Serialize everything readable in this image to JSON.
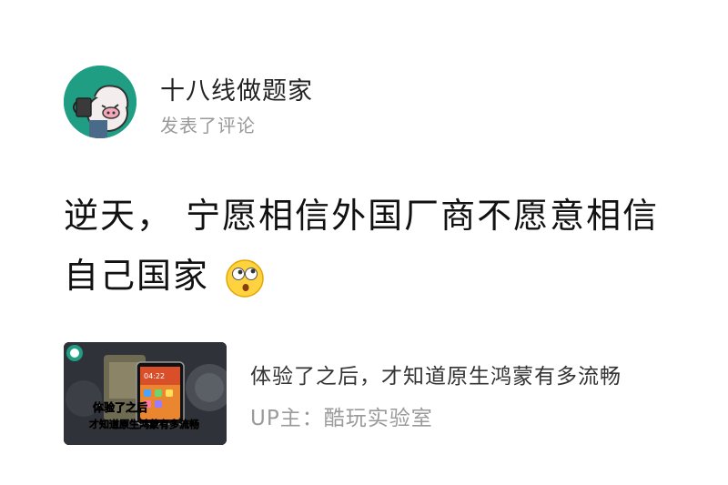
{
  "author": {
    "name": "十八线做题家",
    "action": "发表了评论",
    "avatar_icon": "cartoon-avatar-icon"
  },
  "comment": {
    "text": "逆天， 宁愿相信外国厂商不愿意相信自己国家",
    "emoji": "dizzy-face-emoji"
  },
  "video_card": {
    "title": "体验了之后，才知道原生鸿蒙有多流畅",
    "uploader": "UP主：酷玩实验室",
    "thumbnail_caption_line1": "体验了之后",
    "thumbnail_caption_line2_a": "才知道",
    "thumbnail_caption_line2_b": "原生鸿蒙",
    "thumbnail_caption_line2_c": "有多流畅",
    "thumbnail_clock": "04:22"
  },
  "colors": {
    "avatar_bg": "#1f9e84",
    "caption_yellow": "#ffd400",
    "caption_red": "#e8262b"
  }
}
